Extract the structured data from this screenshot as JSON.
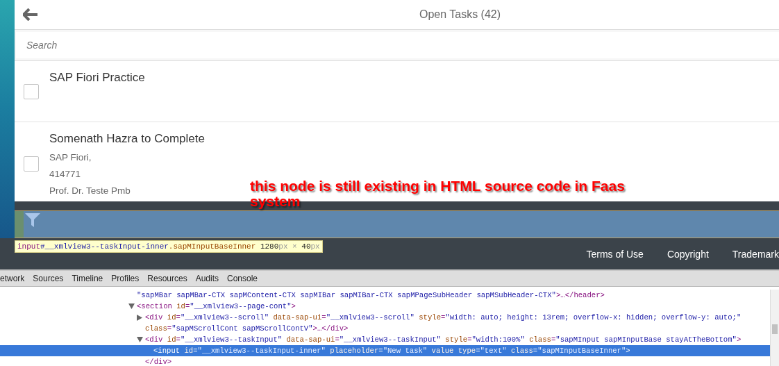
{
  "header": {
    "title": "Open Tasks (42)"
  },
  "search": {
    "placeholder": "Search"
  },
  "tasks": [
    {
      "title": "SAP Fiori Practice",
      "checked": false
    },
    {
      "title": "Somenath Hazra to Complete",
      "details": [
        "SAP Fiori,",
        "414771",
        "Prof. Dr. Teste Pmb"
      ],
      "checked": false
    }
  ],
  "annotation": "this node is still existing in HTML source code in Faas system",
  "inspect_tooltip": [
    {
      "kind": "tag",
      "text": "input"
    },
    {
      "kind": "id",
      "text": "#__xmlview3--taskInput-inner"
    },
    {
      "kind": "class",
      "text": ".sapMInputBaseInner"
    },
    {
      "kind": "num",
      "text": " 1280"
    },
    {
      "kind": "unit",
      "text": "px × "
    },
    {
      "kind": "num",
      "text": "40"
    },
    {
      "kind": "unit",
      "text": "px"
    }
  ],
  "footer_links": [
    "Terms of Use",
    "Copyright",
    "Trademark"
  ],
  "devtools_tabs": [
    {
      "label": "etwork",
      "selected": false
    },
    {
      "label": "Sources",
      "selected": false
    },
    {
      "label": "Timeline",
      "selected": false
    },
    {
      "label": "Profiles",
      "selected": false
    },
    {
      "label": "Resources",
      "selected": false
    },
    {
      "label": "Audits",
      "selected": false
    },
    {
      "label": "Console",
      "selected": false
    }
  ],
  "dom_tree": [
    {
      "selected": false,
      "lines": [
        [
          {
            "kind": "value",
            "text": "\"sapMBar sapMBar-CTX sapMContent-CTX sapMIBar sapMIBar-CTX sapMPageSubHeader sapMSubHeader-CTX\""
          },
          {
            "kind": "tag",
            "text": ">…</header>"
          }
        ]
      ]
    },
    {
      "selected": false,
      "expanded": true,
      "lines": [
        [
          {
            "kind": "tag",
            "text": "<section"
          },
          {
            "kind": "attr",
            "text": " id"
          },
          {
            "kind": "tag",
            "text": "="
          },
          {
            "kind": "value",
            "text": "\"__xmlview3--page-cont\""
          },
          {
            "kind": "tag",
            "text": ">"
          }
        ]
      ],
      "children": [
        {
          "selected": false,
          "expanded": false,
          "lines": [
            [
              {
                "kind": "tag",
                "text": "<div"
              },
              {
                "kind": "attr",
                "text": " id"
              },
              {
                "kind": "tag",
                "text": "="
              },
              {
                "kind": "value",
                "text": "\"__xmlview3--scroll\""
              },
              {
                "kind": "attr",
                "text": " data-sap-ui"
              },
              {
                "kind": "tag",
                "text": "="
              },
              {
                "kind": "value",
                "text": "\"__xmlview3--scroll\""
              },
              {
                "kind": "attr",
                "text": " style"
              },
              {
                "kind": "tag",
                "text": "="
              },
              {
                "kind": "value",
                "text": "\"width: auto; height: 13rem; overflow-x: hidden; overflow-y: auto;\""
              }
            ],
            [
              {
                "kind": "attr",
                "text": "class"
              },
              {
                "kind": "tag",
                "text": "="
              },
              {
                "kind": "value",
                "text": "\"sapMScrollCont sapMScrollContV\""
              },
              {
                "kind": "tag",
                "text": ">…</div>"
              }
            ]
          ]
        },
        {
          "selected": false,
          "expanded": true,
          "lines": [
            [
              {
                "kind": "tag",
                "text": "<div"
              },
              {
                "kind": "attr",
                "text": " id"
              },
              {
                "kind": "tag",
                "text": "="
              },
              {
                "kind": "value",
                "text": "\"__xmlview3--taskInput\""
              },
              {
                "kind": "attr",
                "text": " data-sap-ui"
              },
              {
                "kind": "tag",
                "text": "="
              },
              {
                "kind": "value",
                "text": "\"__xmlview3--taskInput\""
              },
              {
                "kind": "attr",
                "text": " style"
              },
              {
                "kind": "tag",
                "text": "="
              },
              {
                "kind": "value",
                "text": "\"width:100%\""
              },
              {
                "kind": "attr",
                "text": " class"
              },
              {
                "kind": "tag",
                "text": "="
              },
              {
                "kind": "value",
                "text": "\"sapMInput sapMInputBase stayAtTheBottom\""
              },
              {
                "kind": "tag",
                "text": ">"
              }
            ]
          ],
          "children": [
            {
              "selected": true,
              "lines": [
                [
                  {
                    "kind": "tag",
                    "text": "<input"
                  },
                  {
                    "kind": "attr",
                    "text": " id"
                  },
                  {
                    "kind": "tag",
                    "text": "="
                  },
                  {
                    "kind": "value",
                    "text": "\"__xmlview3--taskInput-inner\""
                  },
                  {
                    "kind": "attr",
                    "text": " placeholder"
                  },
                  {
                    "kind": "tag",
                    "text": "="
                  },
                  {
                    "kind": "value",
                    "text": "\"New task\""
                  },
                  {
                    "kind": "attr",
                    "text": " value type"
                  },
                  {
                    "kind": "tag",
                    "text": "="
                  },
                  {
                    "kind": "value",
                    "text": "\"text\""
                  },
                  {
                    "kind": "attr",
                    "text": " class"
                  },
                  {
                    "kind": "tag",
                    "text": "="
                  },
                  {
                    "kind": "value",
                    "text": "\"sapMInputBaseInner\""
                  },
                  {
                    "kind": "tag",
                    "text": ">"
                  }
                ]
              ]
            }
          ],
          "closing": [
            {
              "kind": "tag",
              "text": "</div>"
            }
          ]
        }
      ]
    }
  ]
}
